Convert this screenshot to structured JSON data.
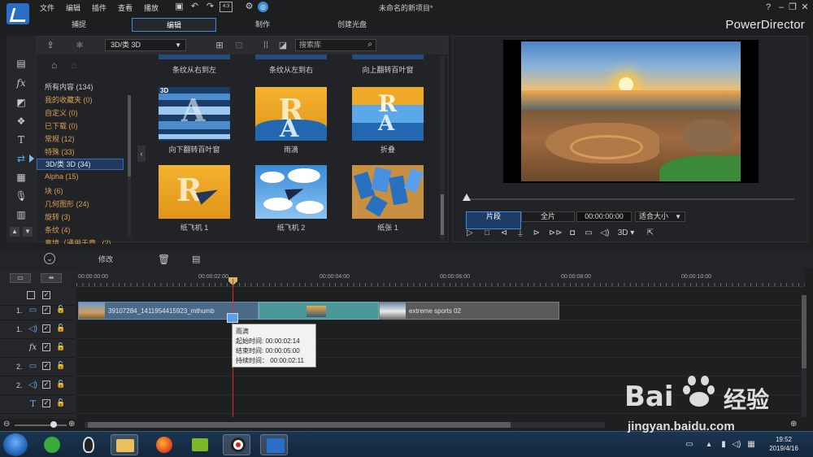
{
  "window": {
    "title": "未命名的新项目*",
    "brand": "PowerDirector",
    "menu": [
      "文件",
      "编辑",
      "插件",
      "查看",
      "播放"
    ],
    "mode_tabs": [
      {
        "label": "捕捉",
        "active": false
      },
      {
        "label": "编辑",
        "active": true
      },
      {
        "label": "制作",
        "active": false
      },
      {
        "label": "创建光盘",
        "active": false
      }
    ],
    "window_buttons": [
      "?",
      "–",
      "❐",
      "✕"
    ]
  },
  "library": {
    "category_dropdown": "3D/类 3D",
    "search_placeholder": "搜索库",
    "categories": [
      {
        "label": "所有内容 (134)",
        "color": "white"
      },
      {
        "label": "我的收藏夹  (0)",
        "color": "orange"
      },
      {
        "label": "自定义  (0)",
        "color": "orange"
      },
      {
        "label": "已下载  (0)",
        "color": "orange"
      },
      {
        "label": "常规  (12)",
        "color": "orange"
      },
      {
        "label": "特殊  (33)",
        "color": "orange"
      },
      {
        "label": "3D/类 3D  (34)",
        "color": "white",
        "active": true
      },
      {
        "label": "Alpha  (15)",
        "color": "orange"
      },
      {
        "label": "块  (6)",
        "color": "orange"
      },
      {
        "label": "几何图形  (24)",
        "color": "orange"
      },
      {
        "label": "旋转  (3)",
        "color": "orange"
      },
      {
        "label": "条纹 (4)",
        "color": "orange"
      },
      {
        "label": "意境（通用于章...(2)",
        "color": "orange"
      }
    ],
    "top_row_labels": [
      "条纹从右到左",
      "条纹从左到右",
      "向上翻转百叶窗"
    ],
    "thumbnails": [
      {
        "label": "向下翻转百叶窗",
        "badge": "3D"
      },
      {
        "label": "雨滴",
        "badge": ""
      },
      {
        "label": "折叠",
        "badge": ""
      },
      {
        "label": "纸飞机 1",
        "badge": ""
      },
      {
        "label": "纸飞机 2",
        "badge": ""
      },
      {
        "label": "纸张 1",
        "badge": ""
      }
    ]
  },
  "preview": {
    "segment_clip": "片段",
    "segment_full": "全片",
    "timecode": "00:00:00:00",
    "fit": "适合大小",
    "stereo_label": "3D"
  },
  "timeline_toolbar": {
    "modify_label": "修改"
  },
  "timeline": {
    "ruler_labels": [
      "00:00:00:00",
      "00:00:02:00",
      "00:00:04:00",
      "00:00:06:00",
      "00:00:08:00",
      "00:00:10:00"
    ],
    "tracks": [
      {
        "num": "1.",
        "type": "video"
      },
      {
        "num": "1.",
        "type": "audio"
      },
      {
        "num": "",
        "type": "fx"
      },
      {
        "num": "2.",
        "type": "video"
      },
      {
        "num": "2.",
        "type": "audio"
      },
      {
        "num": "",
        "type": "title"
      }
    ],
    "clip1_label": "39107284_1411954415923_mthumb",
    "clip2_label": "extreme sports 02",
    "tooltip": {
      "name": "雨滴",
      "start": "起始时间: 00:00:02:14",
      "end": "结束时间: 00:00:05:00",
      "duration": "持续时间： 00:00:02:11"
    }
  },
  "taskbar": {
    "time": "19:52",
    "date": "2019/4/16"
  },
  "watermark": {
    "brand": "Bai",
    "brand2": "经验",
    "url": "jingyan.baidu.com"
  }
}
